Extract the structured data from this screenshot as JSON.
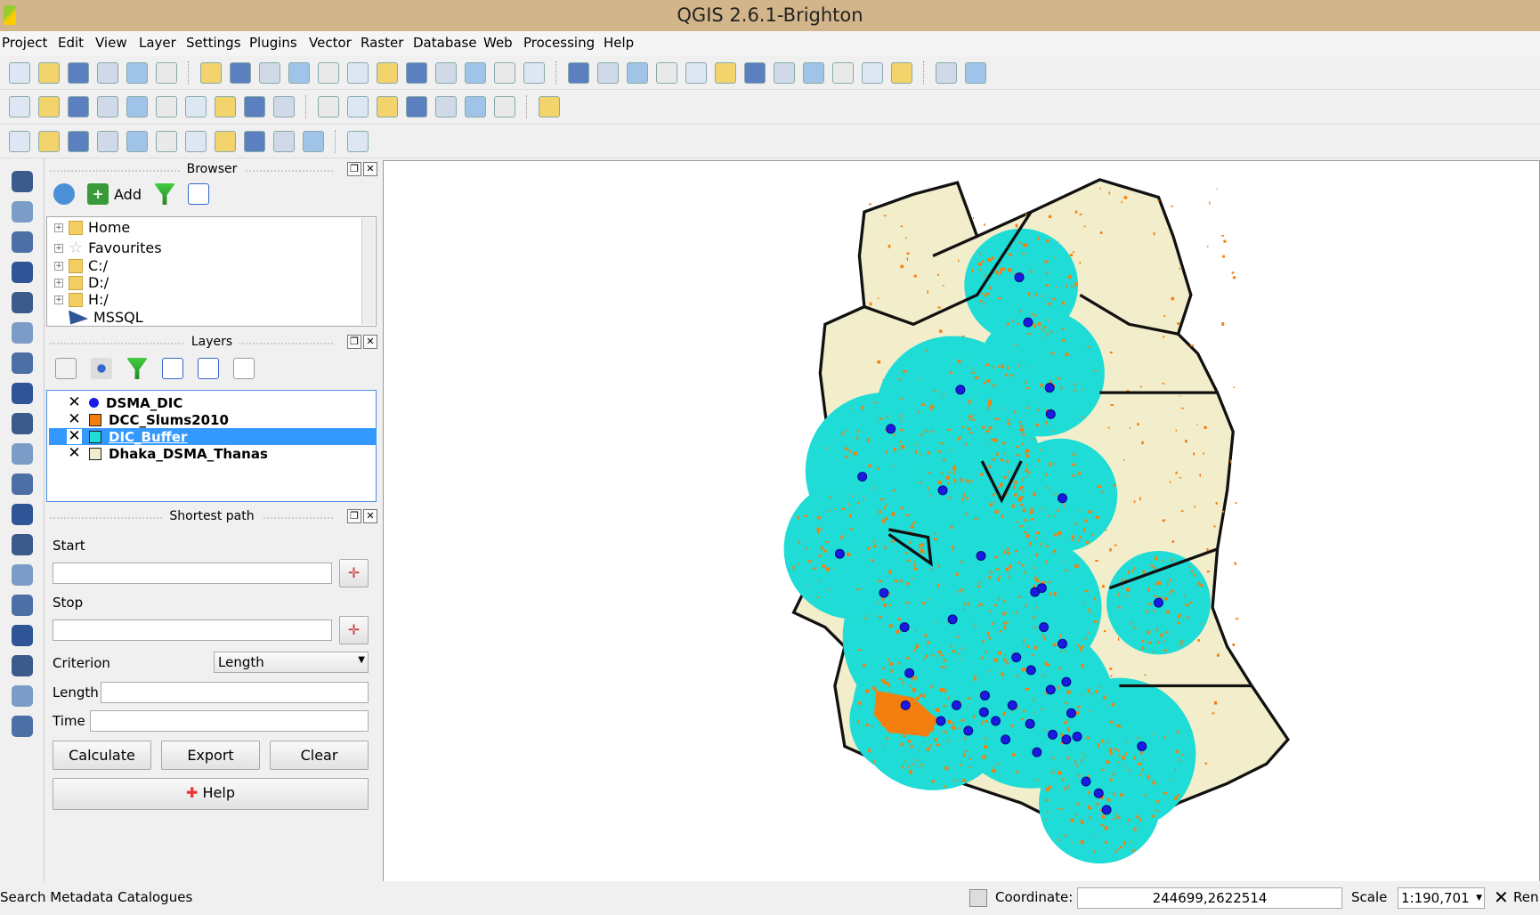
{
  "window": {
    "title": "QGIS 2.6.1-Brighton"
  },
  "menu": [
    "Project",
    "Edit",
    "View",
    "Layer",
    "Settings",
    "Plugins",
    "Vector",
    "Raster",
    "Database",
    "Web",
    "Processing",
    "Help"
  ],
  "browser": {
    "title": "Browser",
    "add_label": "Add",
    "items": [
      "Home",
      "Favourites",
      "C:/",
      "D:/",
      "H:/",
      "MSSQL"
    ]
  },
  "layers": {
    "title": "Layers",
    "items": [
      {
        "name": "DSMA_DIC",
        "symbol": "point",
        "color": "#1a1ae6",
        "checked": true,
        "selected": false
      },
      {
        "name": "DCC_Slums2010",
        "symbol": "fill",
        "color": "#f57f0e",
        "checked": true,
        "selected": false
      },
      {
        "name": "DIC_Buffer",
        "symbol": "fill",
        "color": "#1fdcd6",
        "checked": true,
        "selected": true
      },
      {
        "name": "Dhaka_DSMA_Thanas",
        "symbol": "fill",
        "color": "#f2eecb",
        "checked": true,
        "selected": false
      }
    ]
  },
  "shortest_path": {
    "title": "Shortest path",
    "start_label": "Start",
    "start_value": "",
    "stop_label": "Stop",
    "stop_value": "",
    "criterion_label": "Criterion",
    "criterion_value": "Length",
    "length_label": "Length",
    "length_value": "",
    "time_label": "Time",
    "time_value": "",
    "calculate": "Calculate",
    "export": "Export",
    "clear": "Clear",
    "help": "Help"
  },
  "status": {
    "message": "Search Metadata Catalogues",
    "coordinate_label": "Coordinate:",
    "coordinate": "244699,2622514",
    "scale_label": "Scale",
    "scale": "1:190,701",
    "render_label": "Ren",
    "render_checked": true
  },
  "colors": {
    "buffer": "#1fdcd6",
    "points": "#1a1ae6",
    "slums": "#f57f0e",
    "thanas": "#f2eecb",
    "selection": "#3399ff"
  }
}
